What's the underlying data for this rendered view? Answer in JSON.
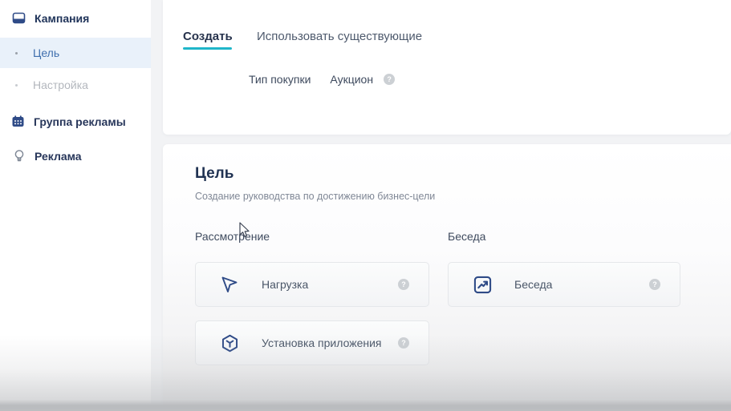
{
  "sidebar": {
    "items": [
      {
        "label": "Кампания",
        "icon": "campaign-icon",
        "state": "default"
      },
      {
        "label": "Цель",
        "icon": "bullet-dot",
        "state": "active"
      },
      {
        "label": "Настройка",
        "icon": "bullet-dot",
        "state": "disabled"
      },
      {
        "label": "Группа рекламы",
        "icon": "ad-group-icon",
        "state": "default"
      },
      {
        "label": "Реклама",
        "icon": "lightbulb-icon",
        "state": "default"
      }
    ]
  },
  "top_panel": {
    "tabs": [
      {
        "label": "Создать",
        "active": true
      },
      {
        "label": "Использовать существующие",
        "active": false
      }
    ],
    "purchase_type": {
      "label": "Тип покупки",
      "value": "Аукцион",
      "help_icon": "question-circle-icon"
    }
  },
  "goal_panel": {
    "title": "Цель",
    "subtitle": "Создание руководства по достижению бизнес-цели",
    "columns": [
      {
        "header": "Рассмотрение",
        "cards": [
          {
            "label": "Нагрузка",
            "icon": "navigation-arrow-icon",
            "help_icon": "question-circle-icon"
          },
          {
            "label": "Установка приложения",
            "icon": "package-box-icon",
            "help_icon": "question-circle-icon"
          }
        ]
      },
      {
        "header": "Беседа",
        "cards": [
          {
            "label": "Беседа",
            "icon": "trend-chart-icon",
            "help_icon": "question-circle-icon"
          }
        ]
      }
    ]
  },
  "colors": {
    "accent_underline": "#1fb6c9",
    "active_item_bg": "#e9f1fa",
    "active_item_text": "#3f6fae",
    "icon_navy": "#2f4b87",
    "heading_navy": "#203252",
    "disabled_text": "#b3b7bd",
    "page_bg": "#f2f3f5",
    "card_border": "#e5e7ea",
    "help_circle": "#ccd0d4"
  },
  "misc": {
    "question_mark": "?"
  }
}
